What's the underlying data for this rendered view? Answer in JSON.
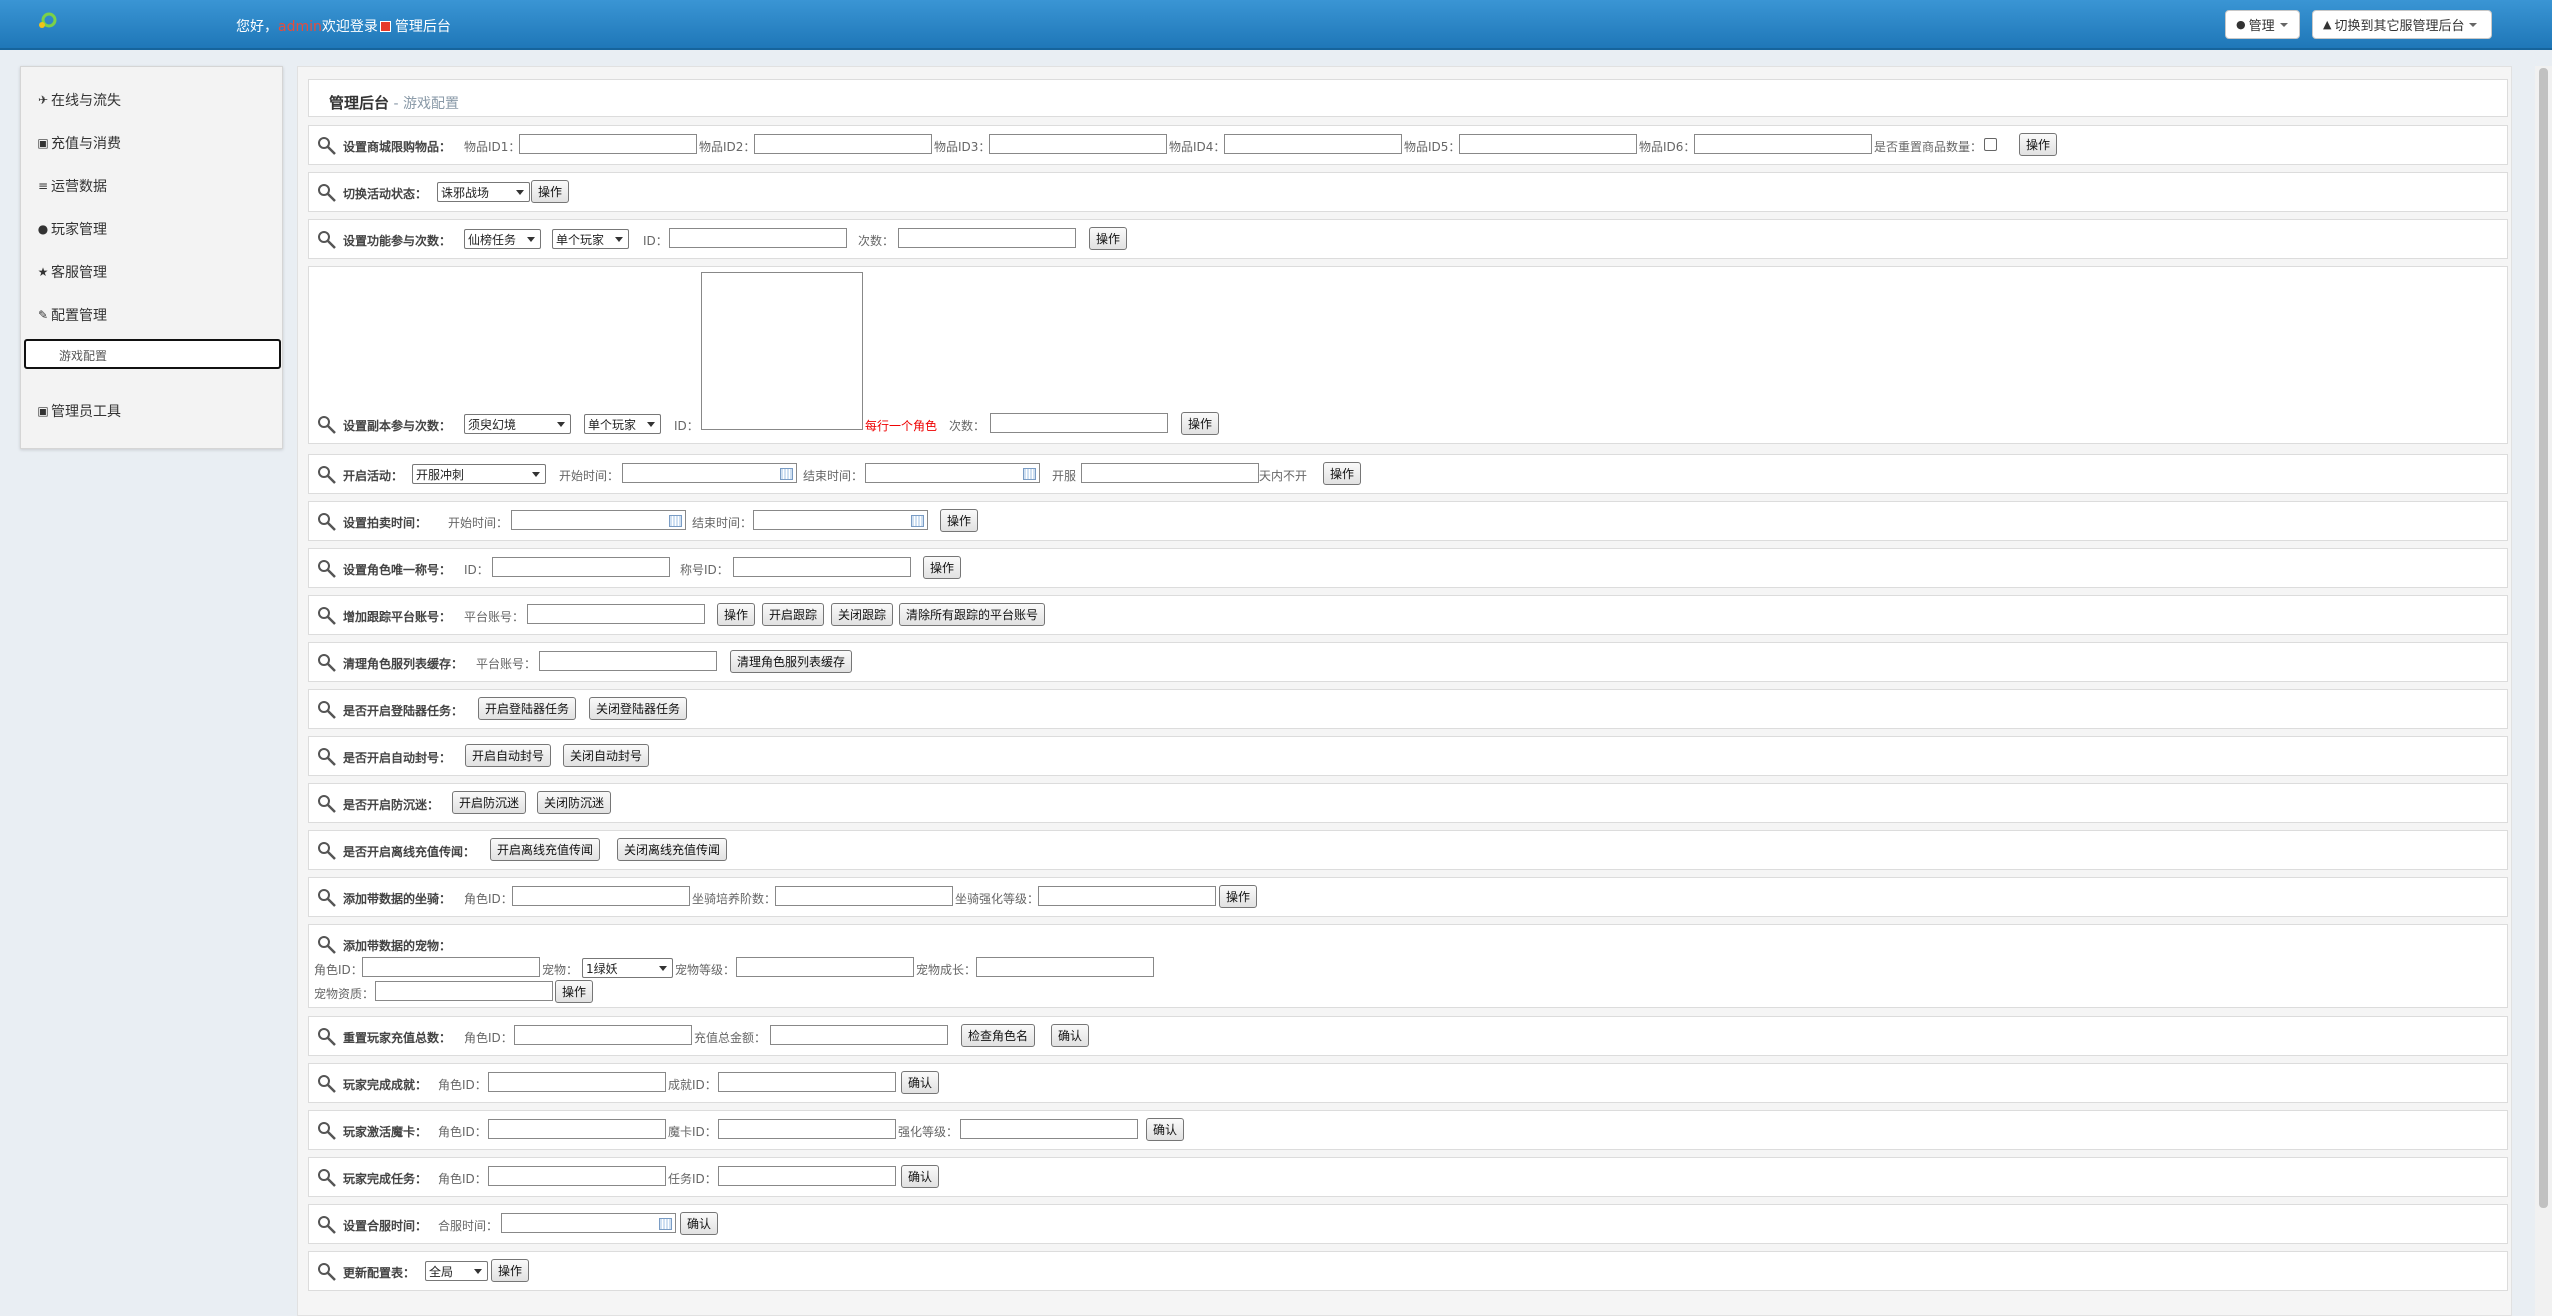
{
  "header": {
    "greeting": "您好，",
    "username": "admin",
    "welcome": "欢迎登录",
    "title": "管理后台",
    "manage_label": "管理",
    "switch_label": "切换到其它服管理后台"
  },
  "sidebar": {
    "items": [
      {
        "label": "在线与流失",
        "icon": "plane-icon"
      },
      {
        "label": "充值与消费",
        "icon": "cart-icon"
      },
      {
        "label": "运营数据",
        "icon": "list-icon"
      },
      {
        "label": "玩家管理",
        "icon": "user-icon"
      },
      {
        "label": "客服管理",
        "icon": "star-icon"
      },
      {
        "label": "配置管理",
        "icon": "edit-icon"
      },
      {
        "label": "管理员工具",
        "icon": "lock-icon"
      }
    ],
    "active_sub": "游戏配置"
  },
  "breadcrumb": {
    "root": "管理后台",
    "sep": " - ",
    "current": "游戏配置"
  },
  "shop_limit": {
    "label": "设置商城限购物品：",
    "fields": [
      "物品ID1：",
      "物品ID2：",
      "物品ID3：",
      "物品ID4：",
      "物品ID5：",
      "物品ID6："
    ],
    "reset_label": "是否重置商品数量：",
    "button": "操作"
  },
  "activity_state": {
    "label": "切换活动状态：",
    "select": "诛邪战场",
    "button": "操作"
  },
  "func_count": {
    "label": "设置功能参与次数：",
    "select1": "仙榜任务",
    "select2": "单个玩家",
    "id_label": "ID：",
    "count_label": "次数：",
    "button": "操作"
  },
  "dungeon_count": {
    "label": "设置副本参与次数：",
    "select1": "须臾幻境",
    "select2": "单个玩家",
    "id_label": "ID：",
    "hint": "每行一个角色",
    "count_label": "次数：",
    "button": "操作"
  },
  "open_activity": {
    "label": "开启活动：",
    "select": "开服冲刺",
    "start_label": "开始时间：",
    "end_label": "结束时间：",
    "open_label": "开服",
    "days_label": "天内不开",
    "button": "操作"
  },
  "auction_time": {
    "label": "设置拍卖时间：",
    "start_label": "开始时间：",
    "end_label": "结束时间：",
    "button": "操作"
  },
  "unique_title": {
    "label": "设置角色唯一称号：",
    "id_label": "ID：",
    "title_label": "称号ID：",
    "button": "操作"
  },
  "track_account": {
    "label": "增加跟踪平台账号：",
    "account_label": "平台账号：",
    "buttons": [
      "操作",
      "开启跟踪",
      "关闭跟踪",
      "清除所有跟踪的平台账号"
    ]
  },
  "clear_cache": {
    "label": "清理角色服列表缓存：",
    "account_label": "平台账号：",
    "button": "清理角色服列表缓存"
  },
  "login_task": {
    "label": "是否开启登陆器任务：",
    "buttons": [
      "开启登陆器任务",
      "关闭登陆器任务"
    ]
  },
  "auto_ban": {
    "label": "是否开启自动封号：",
    "buttons": [
      "开启自动封号",
      "关闭自动封号"
    ]
  },
  "anti_addiction": {
    "label": "是否开启防沉迷：",
    "buttons": [
      "开启防沉迷",
      "关闭防沉迷"
    ]
  },
  "offline_recharge": {
    "label": "是否开启离线充值传闻：",
    "buttons": [
      "开启离线充值传闻",
      "关闭离线充值传闻"
    ]
  },
  "add_mount": {
    "label": "添加带数据的坐骑：",
    "role_label": "角色ID：",
    "train_label": "坐骑培养阶数：",
    "strength_label": "坐骑强化等级：",
    "button": "操作"
  },
  "add_pet": {
    "label": "添加带数据的宠物：",
    "role_label": "角色ID：",
    "pet_label": "宠物：",
    "pet_select": "1绿妖",
    "level_label": "宠物等级：",
    "growth_label": "宠物成长：",
    "aptitude_label": "宠物资质：",
    "button": "操作"
  },
  "reset_recharge": {
    "label": "重置玩家充值总数：",
    "role_label": "角色ID：",
    "amount_label": "充值总金额：",
    "check_button": "检查角色名",
    "confirm": "确认"
  },
  "complete_achievement": {
    "label": "玩家完成成就：",
    "role_label": "角色ID：",
    "ach_label": "成就ID：",
    "confirm": "确认"
  },
  "activate_card": {
    "label": "玩家激活魔卡：",
    "role_label": "角色ID：",
    "card_label": "魔卡ID：",
    "strength_label": "强化等级：",
    "confirm": "确认"
  },
  "complete_task": {
    "label": "玩家完成任务：",
    "role_label": "角色ID：",
    "task_label": "任务ID：",
    "confirm": "确认"
  },
  "merge_time": {
    "label": "设置合服时间：",
    "time_label": "合服时间：",
    "confirm": "确认"
  },
  "update_config": {
    "label": "更新配置表：",
    "select": "全局",
    "button": "操作"
  }
}
